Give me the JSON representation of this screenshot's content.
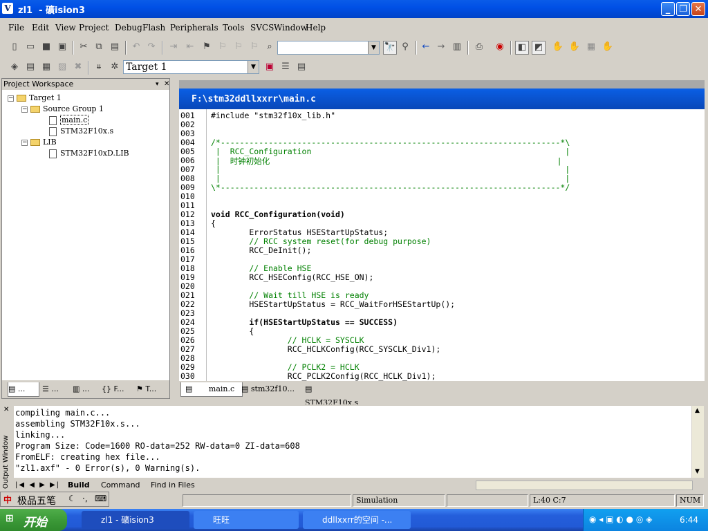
{
  "window": {
    "title": "zl1  - 礦ision3"
  },
  "menu": [
    "File",
    "Edit",
    "View",
    "Project",
    "Debug",
    "Flash",
    "Peripherals",
    "Tools",
    "SVCS",
    "Window",
    "Help"
  ],
  "toolbar": {
    "find_combo_value": "",
    "target_combo_value": "Target 1"
  },
  "workspace": {
    "title": "Project Workspace",
    "tree": {
      "target": "Target 1",
      "group1": "Source Group 1",
      "file1": "main.c",
      "file2": "STM32F10x.s",
      "group2": "LIB",
      "file3": "STM32F10xD.LIB"
    },
    "tabs": [
      "...",
      "...",
      "...",
      "{} F...",
      "T..."
    ]
  },
  "editor": {
    "file_path": "F:\\stm32ddllxxrr\\main.c",
    "lines": [
      {
        "n": "001",
        "t": "#include \"stm32f10x_lib.h\""
      },
      {
        "n": "002",
        "t": ""
      },
      {
        "n": "003",
        "t": ""
      },
      {
        "n": "004",
        "t": "/*-----------------------------------------------------------------------*\\"
      },
      {
        "n": "005",
        "t": " |  RCC_Configuration                                                     |"
      },
      {
        "n": "006",
        "t": " |  时钟初始化                                                            |"
      },
      {
        "n": "007",
        "t": " |                                                                        |"
      },
      {
        "n": "008",
        "t": " |                                                                        |"
      },
      {
        "n": "009",
        "t": "\\*-----------------------------------------------------------------------*/"
      },
      {
        "n": "010",
        "t": ""
      },
      {
        "n": "011",
        "t": ""
      },
      {
        "n": "012",
        "t": "void RCC_Configuration(void)"
      },
      {
        "n": "013",
        "t": "{"
      },
      {
        "n": "014",
        "t": "        ErrorStatus HSEStartUpStatus;"
      },
      {
        "n": "015",
        "t": "        // RCC system reset(for debug purpose)"
      },
      {
        "n": "016",
        "t": "        RCC_DeInit();"
      },
      {
        "n": "017",
        "t": ""
      },
      {
        "n": "018",
        "t": "        // Enable HSE"
      },
      {
        "n": "019",
        "t": "        RCC_HSEConfig(RCC_HSE_ON);"
      },
      {
        "n": "020",
        "t": ""
      },
      {
        "n": "021",
        "t": "        // Wait till HSE is ready"
      },
      {
        "n": "022",
        "t": "        HSEStartUpStatus = RCC_WaitForHSEStartUp();"
      },
      {
        "n": "023",
        "t": ""
      },
      {
        "n": "024",
        "t": "        if(HSEStartUpStatus == SUCCESS)"
      },
      {
        "n": "025",
        "t": "        {"
      },
      {
        "n": "026",
        "t": "                // HCLK = SYSCLK"
      },
      {
        "n": "027",
        "t": "                RCC_HCLKConfig(RCC_SYSCLK_Div1);"
      },
      {
        "n": "028",
        "t": ""
      },
      {
        "n": "029",
        "t": "                // PCLK2 = HCLK"
      },
      {
        "n": "030",
        "t": "                RCC_PCLK2Config(RCC_HCLK_Div1);"
      }
    ],
    "tabs": [
      "main.c",
      "stm32f10...",
      "STM32F10x.s"
    ]
  },
  "output": {
    "side_label": "Output Window",
    "lines": [
      "compiling main.c...",
      "assembling STM32F10x.s...",
      "linking...",
      "Program Size: Code=1600 RO-data=252 RW-data=0 ZI-data=608",
      "FromELF: creating hex file...",
      "\"zl1.axf\" - 0 Error(s), 0 Warning(s)."
    ],
    "tabs": [
      "Build",
      "Command",
      "Find in Files"
    ]
  },
  "ime": {
    "label": "极品五笔"
  },
  "status": {
    "mode": "Simulation",
    "position": "L:40 C:7",
    "num": "NUM"
  },
  "taskbar": {
    "start": "开始",
    "tasks": [
      "zl1  - 礦ision3",
      "旺旺",
      "ddllxxrr的空间 -..."
    ],
    "clock": "6:44"
  }
}
